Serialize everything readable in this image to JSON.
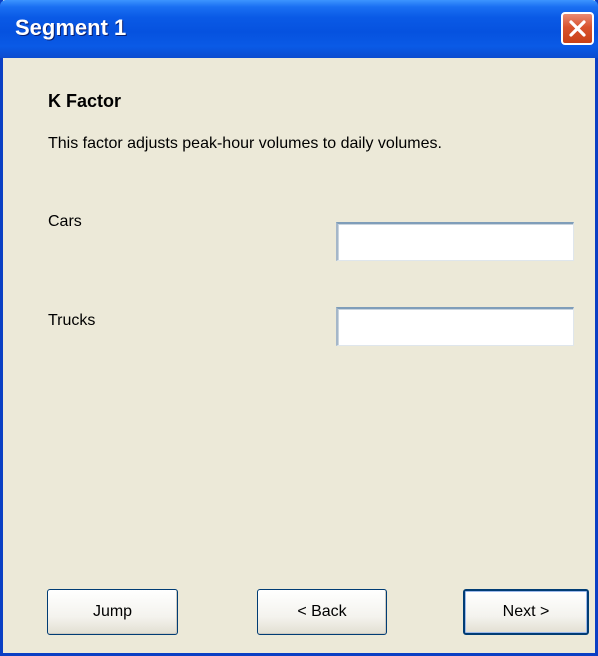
{
  "window": {
    "title": "Segment 1"
  },
  "icons": {
    "close": "close-icon"
  },
  "colors": {
    "titlebar": "#0a5ae6",
    "window_border": "#0a3fc4",
    "background": "#ece9d8",
    "close_button": "#d9532d"
  },
  "page": {
    "heading": "K Factor",
    "description": "This factor adjusts peak-hour volumes to daily volumes."
  },
  "fields": {
    "cars": {
      "label": "Cars",
      "value": ""
    },
    "trucks": {
      "label": "Trucks",
      "value": ""
    }
  },
  "buttons": {
    "jump": "Jump",
    "back": "< Back",
    "next": "Next >"
  }
}
